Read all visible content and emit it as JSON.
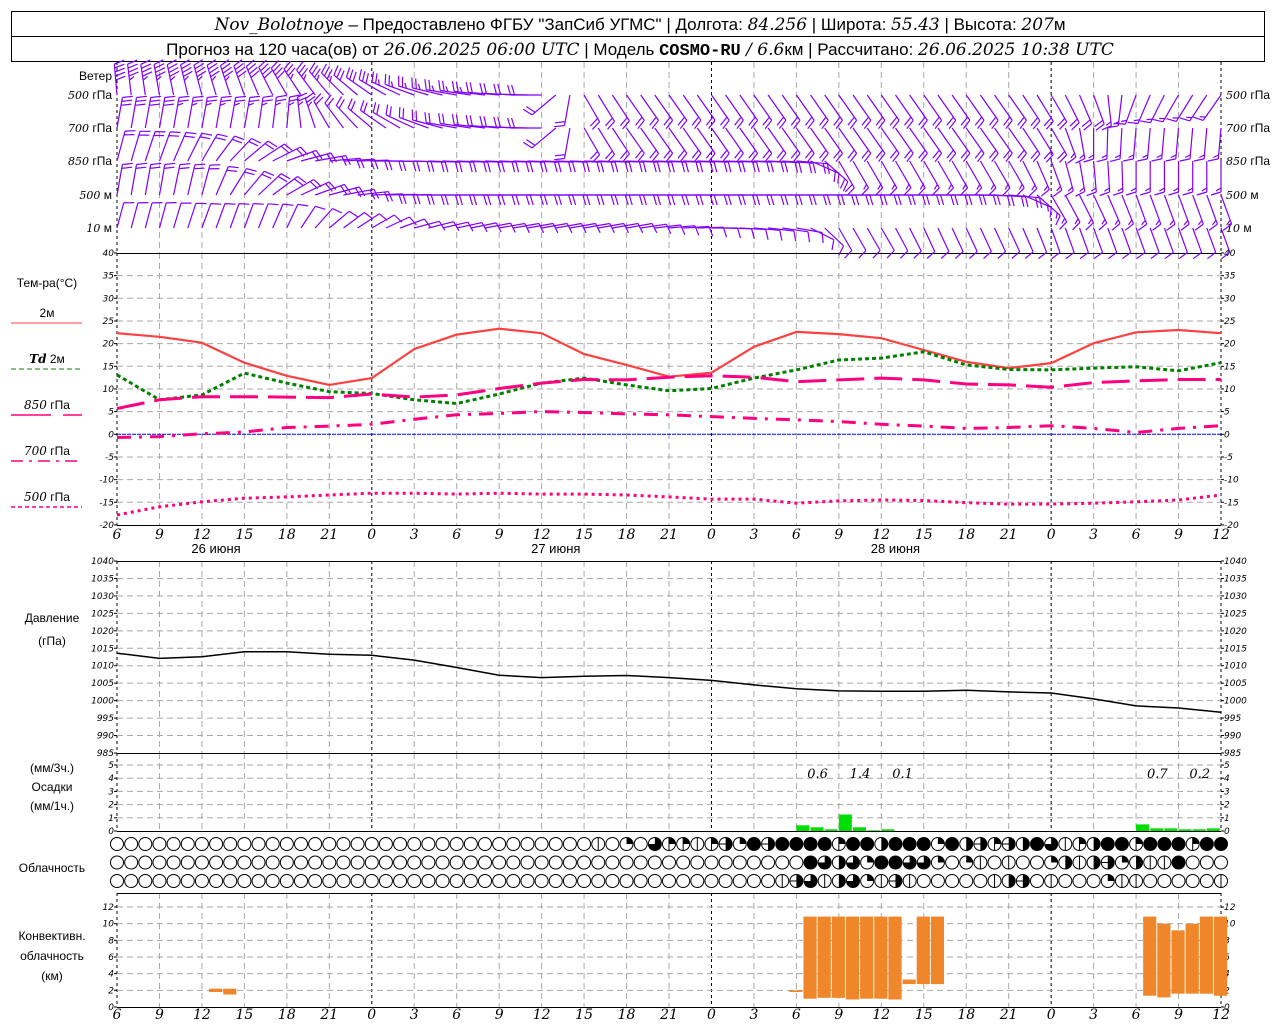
{
  "header": {
    "station": "Nov_Bolotnoye",
    "provider": " – Предоставлено ФГБУ \"ЗапСиб УГМС\" | Долгота: ",
    "lon": "84.256",
    "lat_label": " | Широта: ",
    "lat": "55.43",
    "alt_label": " | Высота: ",
    "alt": "207",
    "alt_unit": "м",
    "forecast_label": "Прогноз на 120 часа(ов) от ",
    "forecast_time": "26.06.2025 06:00 UTC",
    "model_label": "  | Модель ",
    "model": "COSMO-RU",
    "resolution": " / 6.6",
    "res_unit": "км",
    "computed_label": " | Рассчитано: ",
    "computed_time": "26.06.2025 10:38 UTC"
  },
  "colors": {
    "wind": "#8000ff",
    "t2m": "#ff4040",
    "td": "#008000",
    "upper": "#ff0080",
    "zero": "#0000ff",
    "pressure": "#000000",
    "precip": "#00dd00",
    "conv": "#f0862a",
    "grid": "#a8a8a8"
  },
  "wind": {
    "title": "Ветер",
    "levels": [
      {
        "label_num": "500",
        "label_unit": " гПа",
        "dir": [
          355,
          350,
          345,
          340,
          330,
          320,
          305,
          290,
          280,
          275,
          270,
          150,
          145,
          145,
          145,
          145,
          145,
          145,
          145,
          145,
          145,
          145,
          150,
          160,
          200,
          210,
          215
        ],
        "speed": [
          24,
          23,
          22,
          21,
          19,
          17,
          15,
          13,
          12,
          11,
          10,
          10,
          10,
          10,
          10,
          10,
          9,
          9,
          9,
          9,
          9,
          9,
          9,
          9,
          8,
          8,
          8
        ]
      },
      {
        "label_num": "700",
        "label_unit": " гПа",
        "dir": [
          10,
          10,
          10,
          10,
          5,
          330,
          310,
          295,
          280,
          275,
          270,
          150,
          145,
          145,
          145,
          145,
          145,
          145,
          145,
          145,
          145,
          145,
          150,
          180,
          185,
          185,
          185
        ],
        "speed": [
          14,
          14,
          13,
          13,
          12,
          11,
          10,
          10,
          10,
          10,
          10,
          9,
          9,
          9,
          9,
          9,
          9,
          9,
          9,
          9,
          9,
          9,
          9,
          8,
          8,
          8,
          8
        ]
      },
      {
        "label_num": "850",
        "label_unit": " гПа",
        "dir": [
          15,
          20,
          30,
          50,
          70,
          85,
          90,
          92,
          92,
          92,
          92,
          92,
          92,
          92,
          92,
          92,
          95,
          150,
          150,
          150,
          150,
          150,
          160,
          175,
          180,
          180,
          180
        ],
        "speed": [
          10,
          10,
          10,
          10,
          10,
          10,
          10,
          10,
          10,
          10,
          10,
          10,
          10,
          10,
          10,
          10,
          9,
          9,
          8,
          8,
          8,
          8,
          8,
          7,
          7,
          7,
          7
        ]
      },
      {
        "label_num": "500",
        "label_unit": " м",
        "dir": [
          10,
          10,
          15,
          40,
          60,
          75,
          88,
          90,
          90,
          90,
          90,
          90,
          90,
          90,
          90,
          90,
          90,
          90,
          90,
          90,
          90,
          95,
          150,
          155,
          160,
          160,
          160
        ],
        "speed": [
          9,
          9,
          9,
          9,
          9,
          9,
          10,
          10,
          10,
          10,
          10,
          10,
          10,
          10,
          10,
          10,
          10,
          10,
          10,
          10,
          10,
          9,
          8,
          8,
          8,
          8,
          8
        ]
      },
      {
        "label_num": "10",
        "label_unit": "  м",
        "dir": [
          15,
          15,
          20,
          20,
          25,
          50,
          60,
          75,
          78,
          80,
          80,
          80,
          80,
          85,
          90,
          95,
          100,
          150,
          150,
          155,
          155,
          155,
          160,
          160,
          160,
          160,
          160
        ],
        "speed": [
          4,
          4,
          4,
          4,
          4,
          4,
          5,
          5,
          5,
          5,
          5,
          5,
          5,
          5,
          5,
          5,
          4,
          4,
          4,
          4,
          4,
          4,
          4,
          4,
          4,
          4,
          4
        ]
      }
    ]
  },
  "temperature": {
    "title": "Тем-ра(°C)",
    "legend": [
      {
        "num": "",
        "text": "2м"
      },
      {
        "num": "Td",
        "text": "  2м"
      },
      {
        "num": "850",
        "text": " гПа"
      },
      {
        "num": "700",
        "text": " гПа"
      },
      {
        "num": "500",
        "text": " гПа"
      }
    ],
    "ticks": [
      "40",
      "35",
      "30",
      "25",
      "20",
      "15",
      "10",
      "5",
      "0",
      "-5",
      "-10",
      "-15",
      "-20"
    ]
  },
  "pressure": {
    "title": "Давление",
    "unit": "(гПа)",
    "ticks": [
      "1040",
      "1035",
      "1030",
      "1025",
      "1020",
      "1015",
      "1010",
      "1005",
      "1000",
      "995",
      "990",
      "985"
    ]
  },
  "precip": {
    "label_3h": "(мм/3ч.)",
    "title": "Осадки",
    "label_1h": "(мм/1ч.)",
    "ticks": [
      "0",
      "1",
      "2",
      "3",
      "4",
      "5"
    ],
    "totals": [
      {
        "text": "0.6",
        "hour": 49.5
      },
      {
        "text": "1.4",
        "hour": 52.5
      },
      {
        "text": "0.1",
        "hour": 55.5
      },
      {
        "text": "0.7",
        "hour": 73.5
      },
      {
        "text": "0.2",
        "hour": 76.5
      }
    ]
  },
  "cloud": {
    "title": "Облачность",
    "rows": [
      "oooooooooooooooooooooooooooooooooo|oqotQQ|QHqfHffffQffhfffqfhHQHhft|QhffQfffQff",
      "ooooooooooooooooooooooooooooooooooooooooooooooooofthtqffttqoq|o|ooqh|hHqh||fooo",
      "ooooooooooooooooooooooooooooooooooooooooooooooo|Ht|htq|H|ooooo|hHo|oooq||ooooo|"
    ]
  },
  "conv": {
    "title1": "Конвективн.",
    "title2": "облачность",
    "unit": "(км)",
    "ticks": [
      "0",
      "2",
      "4",
      "6",
      "8",
      "10",
      "12"
    ]
  },
  "x_axis": {
    "tick_labels": [
      "6",
      "9",
      "12",
      "15",
      "18",
      "21",
      "0",
      "3",
      "6",
      "9",
      "12",
      "15",
      "18",
      "21",
      "0",
      "3",
      "6",
      "9",
      "12",
      "15",
      "18",
      "21",
      "0",
      "3",
      "6",
      "9",
      "12"
    ],
    "dates": [
      {
        "text": "26 июня",
        "hour": 7
      },
      {
        "text": "27 июня",
        "hour": 31
      },
      {
        "text": "28 июня",
        "hour": 55
      }
    ]
  },
  "chart_data": [
    {
      "type": "line",
      "title": "Тем-ра(°C)",
      "x_hours_from_start": "0..78 step 3",
      "ylim": [
        -20,
        40
      ],
      "series": [
        {
          "name": "2м",
          "values": [
            22.3,
            21.5,
            20.2,
            15.8,
            12.9,
            10.9,
            12.4,
            18.8,
            22.0,
            23.3,
            22.3,
            17.7,
            15.3,
            12.7,
            13.6,
            19.3,
            22.6,
            22.1,
            21.2,
            18.6,
            16.0,
            14.6,
            15.7,
            20.1,
            22.5,
            23.0,
            22.3
          ]
        },
        {
          "name": "Td 2м",
          "values": [
            13.1,
            7.6,
            8.7,
            13.5,
            11.3,
            9.4,
            9.0,
            7.6,
            6.8,
            8.9,
            11.3,
            12.4,
            10.9,
            9.6,
            10.1,
            12.4,
            14.2,
            16.4,
            16.8,
            18.2,
            15.3,
            14.3,
            14.2,
            14.6,
            14.9,
            14.0,
            15.8
          ]
        },
        {
          "name": "850 гПа",
          "values": [
            5.7,
            7.6,
            8.3,
            8.3,
            8.2,
            8.1,
            8.9,
            8.2,
            8.7,
            10.1,
            11.3,
            12.1,
            12.0,
            12.6,
            12.9,
            12.6,
            11.6,
            12.0,
            12.4,
            12.0,
            11.1,
            10.9,
            10.4,
            11.4,
            11.8,
            12.1,
            12.1
          ]
        },
        {
          "name": "700 гПа",
          "values": [
            -0.7,
            -0.5,
            0.1,
            0.5,
            1.5,
            1.8,
            2.2,
            3.3,
            4.3,
            4.6,
            5.0,
            4.8,
            4.5,
            4.3,
            3.9,
            3.5,
            3.2,
            2.8,
            2.2,
            1.8,
            1.3,
            1.5,
            1.9,
            1.3,
            0.4,
            1.3,
            1.9
          ]
        },
        {
          "name": "500 гПа",
          "values": [
            -17.8,
            -16.0,
            -14.9,
            -14.1,
            -13.8,
            -13.4,
            -13.0,
            -13.0,
            -13.2,
            -13.0,
            -13.2,
            -13.2,
            -13.4,
            -13.8,
            -14.3,
            -14.3,
            -15.2,
            -14.7,
            -14.5,
            -14.6,
            -15.1,
            -15.4,
            -15.4,
            -15.2,
            -14.9,
            -14.5,
            -13.4
          ]
        }
      ]
    },
    {
      "type": "line",
      "title": "Давление (гПа)",
      "x_hours_from_start": "0..78 step 3",
      "ylim": [
        985,
        1040
      ],
      "values": [
        1013.6,
        1012.1,
        1012.6,
        1014.0,
        1014.0,
        1013.3,
        1013.0,
        1011.6,
        1009.5,
        1007.3,
        1006.6,
        1007.0,
        1007.2,
        1006.6,
        1005.8,
        1004.5,
        1003.4,
        1002.8,
        1002.7,
        1002.7,
        1003.0,
        1002.5,
        1002.2,
        1000.5,
        998.5,
        997.9,
        996.7
      ]
    },
    {
      "type": "bar",
      "title": "Осадки (мм/1ч.)",
      "ylim": [
        0,
        5
      ],
      "bars": [
        {
          "hour": 48,
          "value": 0.43
        },
        {
          "hour": 49,
          "value": 0.28
        },
        {
          "hour": 50,
          "value": 0.13
        },
        {
          "hour": 51,
          "value": 1.25
        },
        {
          "hour": 52,
          "value": 0.28
        },
        {
          "hour": 53,
          "value": 0.05
        },
        {
          "hour": 54,
          "value": 0.13
        },
        {
          "hour": 72,
          "value": 0.5
        },
        {
          "hour": 73,
          "value": 0.2
        },
        {
          "hour": 74,
          "value": 0.2
        },
        {
          "hour": 75,
          "value": 0.13
        },
        {
          "hour": 76,
          "value": 0.13
        },
        {
          "hour": 77,
          "value": 0.2
        }
      ]
    },
    {
      "type": "bar",
      "title": "Конвективн. облачность (км)",
      "ylim": [
        0,
        12
      ],
      "bars": [
        {
          "hour": 6.5,
          "base": 1.8,
          "top": 2.2
        },
        {
          "hour": 7.5,
          "base": 1.5,
          "top": 2.2
        },
        {
          "hour": 47.5,
          "base": 1.8,
          "top": 2.0
        },
        {
          "hour": 48.5,
          "base": 1.0,
          "top": 10.85
        },
        {
          "hour": 49.5,
          "base": 1.1,
          "top": 10.85
        },
        {
          "hour": 50.5,
          "base": 1.1,
          "top": 10.85
        },
        {
          "hour": 51.5,
          "base": 0.9,
          "top": 10.85
        },
        {
          "hour": 52.5,
          "base": 1.0,
          "top": 10.85
        },
        {
          "hour": 53.5,
          "base": 1.0,
          "top": 10.85
        },
        {
          "hour": 54.5,
          "base": 0.9,
          "top": 10.85
        },
        {
          "hour": 55.5,
          "base": 2.75,
          "top": 3.3
        },
        {
          "hour": 56.5,
          "base": 2.75,
          "top": 10.85
        },
        {
          "hour": 57.5,
          "base": 2.75,
          "top": 10.85
        },
        {
          "hour": 72.5,
          "base": 1.35,
          "top": 10.85
        },
        {
          "hour": 73.5,
          "base": 1.15,
          "top": 10.0
        },
        {
          "hour": 74.5,
          "base": 1.6,
          "top": 9.2
        },
        {
          "hour": 75.5,
          "base": 1.6,
          "top": 10.0
        },
        {
          "hour": 76.5,
          "base": 1.6,
          "top": 10.85
        },
        {
          "hour": 77.5,
          "base": 1.35,
          "top": 10.85
        }
      ]
    }
  ]
}
